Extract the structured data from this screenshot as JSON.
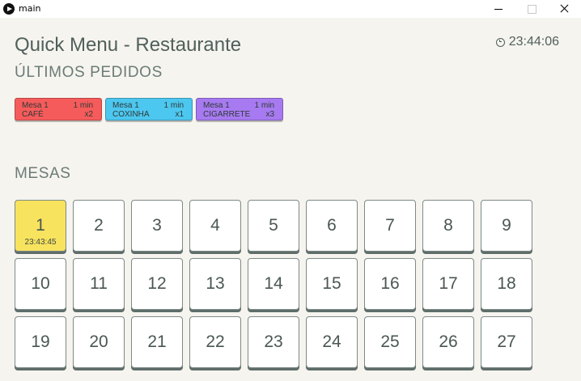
{
  "window": {
    "title": "main"
  },
  "header": {
    "title": "Quick Menu - Restaurante",
    "clock": "23:44:06"
  },
  "orders_section": {
    "title": "ÚLTIMOS PEDIDOS",
    "orders": [
      {
        "table": "Mesa 1",
        "time": "1 min",
        "item": "CAFÉ",
        "qty": "x2",
        "color": "#f65b5b"
      },
      {
        "table": "Mesa 1",
        "time": "1 min",
        "item": "COXINHA",
        "qty": "x1",
        "color": "#4cc7ef"
      },
      {
        "table": "Mesa 1",
        "time": "1 min",
        "item": "CIGARRETE",
        "qty": "x3",
        "color": "#a77af1"
      }
    ]
  },
  "tables_section": {
    "title": "MESAS",
    "tables": [
      {
        "number": "1",
        "time": "23:43:45",
        "occupied": true
      },
      {
        "number": "2"
      },
      {
        "number": "3"
      },
      {
        "number": "4"
      },
      {
        "number": "5"
      },
      {
        "number": "6"
      },
      {
        "number": "7"
      },
      {
        "number": "8"
      },
      {
        "number": "9"
      },
      {
        "number": "10"
      },
      {
        "number": "11"
      },
      {
        "number": "12"
      },
      {
        "number": "13"
      },
      {
        "number": "14"
      },
      {
        "number": "15"
      },
      {
        "number": "16"
      },
      {
        "number": "17"
      },
      {
        "number": "18"
      },
      {
        "number": "19"
      },
      {
        "number": "20"
      },
      {
        "number": "21"
      },
      {
        "number": "22"
      },
      {
        "number": "23"
      },
      {
        "number": "24"
      },
      {
        "number": "25"
      },
      {
        "number": "26"
      },
      {
        "number": "27"
      }
    ]
  },
  "colors": {
    "occupied": "#f8e35e",
    "text": "#50605c",
    "background": "#f6f4ef"
  }
}
